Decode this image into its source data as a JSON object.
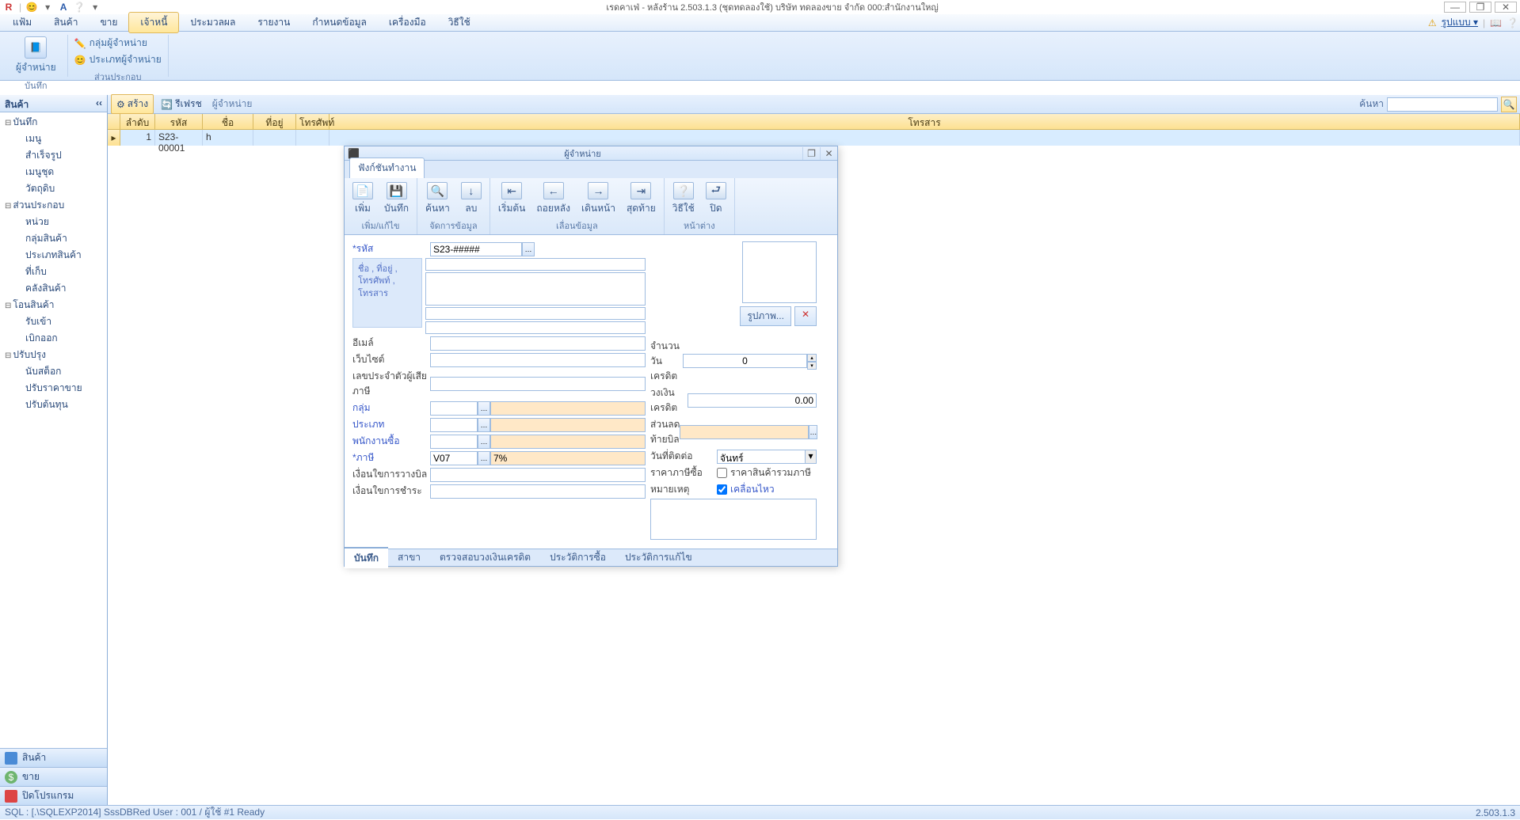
{
  "titlebar": {
    "title": "เรดคาเฟ่ - หลังร้าน 2.503.1.3 (ชุดทดลองใช้) บริษัท ทดลองขาย จำกัด 000:สำนักงานใหญ่"
  },
  "menubar": {
    "items": [
      "แฟ้ม",
      "สินค้า",
      "ขาย",
      "เจ้าหนี้",
      "ประมวลผล",
      "รายงาน",
      "กำหนดข้อมูล",
      "เครื่องมือ",
      "วิธีใช้"
    ],
    "active_index": 3,
    "form_label": "รูปแบบ ▾"
  },
  "ribbon": {
    "big_label": "ผู้จำหน่าย",
    "group1": [
      "กลุ่มผู้จำหน่าย",
      "ประเภทผู้จำหน่าย"
    ],
    "section1": "บันทึก",
    "section2": "ส่วนประกอบ"
  },
  "outlook": {
    "header": "สินค้า",
    "nodes": [
      {
        "label": "บันทึก",
        "root": true
      },
      {
        "label": "เมนู"
      },
      {
        "label": "สำเร็จรูป"
      },
      {
        "label": "เมนูชุด"
      },
      {
        "label": "วัตถุดิบ"
      },
      {
        "label": "ส่วนประกอบ",
        "root": true
      },
      {
        "label": "หน่วย"
      },
      {
        "label": "กลุ่มสินค้า"
      },
      {
        "label": "ประเภทสินค้า"
      },
      {
        "label": "ที่เก็บ"
      },
      {
        "label": "คลังสินค้า"
      },
      {
        "label": "โอนสินค้า",
        "root": true
      },
      {
        "label": "รับเข้า"
      },
      {
        "label": "เบิกออก"
      },
      {
        "label": "ปรับปรุง",
        "root": true
      },
      {
        "label": "นับสต็อก"
      },
      {
        "label": "ปรับราคาขาย"
      },
      {
        "label": "ปรับต้นทุน"
      }
    ],
    "buttons": [
      "สินค้า",
      "ขาย",
      "ปิดโปรแกรม"
    ]
  },
  "toolbar": {
    "create": "สร้าง",
    "refresh": "รีเฟรช",
    "breadcrumb": "ผู้จำหน่าย",
    "search_label": "ค้นหา"
  },
  "grid": {
    "headers": [
      "ลำดับ",
      "รหัส",
      "ชื่อ",
      "ที่อยู่",
      "โทรศัพท์",
      "โทรสาร"
    ],
    "widths": [
      44,
      60,
      64,
      54,
      42,
      1100
    ],
    "row": [
      "1",
      "S23-00001",
      "h",
      "",
      "",
      ""
    ]
  },
  "dialog": {
    "title": "ผู้จำหน่าย",
    "tab": "ฟังก์ชันทำงาน",
    "ribbon_groups": [
      {
        "label": "เพิ่ม/แก้ไข",
        "btns": [
          {
            "icon": "📄",
            "label": "เพิ่ม"
          },
          {
            "icon": "💾",
            "label": "บันทึก"
          }
        ]
      },
      {
        "label": "จัดการข้อมูล",
        "btns": [
          {
            "icon": "🔍",
            "label": "ค้นหา"
          },
          {
            "icon": "↓",
            "label": "ลบ"
          }
        ]
      },
      {
        "label": "เลื่อนข้อมูล",
        "btns": [
          {
            "icon": "⇤",
            "label": "เริ่มต้น"
          },
          {
            "icon": "←",
            "label": "ถอยหลัง"
          },
          {
            "icon": "→",
            "label": "เดินหน้า"
          },
          {
            "icon": "⇥",
            "label": "สุดท้าย"
          }
        ]
      },
      {
        "label": "หน้าต่าง",
        "btns": [
          {
            "icon": "❔",
            "label": "วิธีใช้"
          },
          {
            "icon": "⮐",
            "label": "ปิด"
          }
        ]
      }
    ],
    "form": {
      "code_label": "รหัส",
      "code_value": "S23-#####",
      "name_block_label": "ชื่อ , ที่อยู่ , โทรศัพท์ , โทรสาร",
      "email": "อีเมล์",
      "website": "เว็บไซต์",
      "taxid": "เลขประจำตัวผู้เสียภาษี",
      "group": "กลุ่ม",
      "type": "ประเภท",
      "buyer": "พนักงานซื้อ",
      "tax": "ภาษี",
      "tax_code": "V07",
      "tax_desc": "7%",
      "deposit_cond": "เงื่อนใขการวางบิล",
      "pay_cond": "เงื่อนใขการชำระ",
      "image_btn": "รูปภาพ...",
      "credit_days": "จำนวนวันเครดิต",
      "credit_days_val": "0",
      "credit_limit": "วงเงินเครดิต",
      "credit_limit_val": "0.00",
      "bill_discount": "ส่วนลดท้ายบิล",
      "contact_day": "วันที่ติดต่อ",
      "contact_day_val": "จันทร์",
      "price_incl": "ราคาภาษีซื้อ",
      "price_incl_chk": "ราคาสินค้ารวมภาษี",
      "remark": "หมายเหตุ",
      "active_chk": "เคลื่อนไหว"
    },
    "bottom_tabs": [
      "บันทึก",
      "สาขา",
      "ตรวจสอบวงเงินเครดิต",
      "ประวัติการซื้อ",
      "ประวัติการแก้ไข"
    ]
  },
  "statusbar": {
    "text": "SQL : [.\\SQLEXP2014] SssDBRed   User : 001 / ผู้ใช้ #1   Ready",
    "version": "2.503.1.3"
  }
}
